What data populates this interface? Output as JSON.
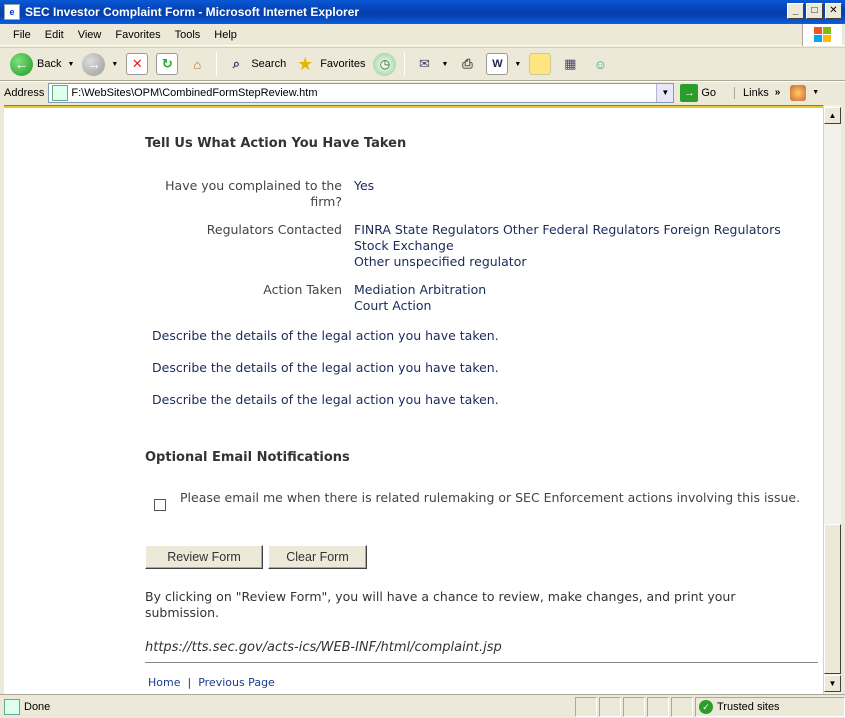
{
  "window": {
    "title": "SEC Investor Complaint Form - Microsoft Internet Explorer",
    "app_icon": "e",
    "minimize": "_",
    "maximize": "□",
    "close": "✕"
  },
  "menu": [
    "File",
    "Edit",
    "View",
    "Favorites",
    "Tools",
    "Help"
  ],
  "toolbar": {
    "back": "Back",
    "search": "Search",
    "favorites": "Favorites"
  },
  "address": {
    "label": "Address",
    "value": "F:\\WebSites\\OPM\\CombinedFormStepReview.htm",
    "go": "Go",
    "links": "Links"
  },
  "page": {
    "section1_title": "Tell Us What Action You Have Taken",
    "complained_label": "Have you complained to the firm?",
    "complained_value": "Yes",
    "regulators_label": "Regulators Contacted",
    "regulators_value": [
      "FINRA State Regulators Other Federal Regulators Foreign Regulators",
      "Stock Exchange",
      "Other unspecified regulator"
    ],
    "action_label": "Action Taken",
    "action_value": [
      "Mediation Arbitration",
      "Court Action"
    ],
    "details": [
      "Describe the details of the legal action you have taken.",
      "Describe the details of the legal action you have taken.",
      "Describe the details of the legal action you have taken."
    ],
    "section2_title": "Optional Email Notifications",
    "email_checkbox_label": "Please email me when there is related rulemaking or SEC Enforcement actions involving this issue.",
    "review_button": "Review Form",
    "clear_button": "Clear Form",
    "note": "By clicking on \"Review Form\", you will have a chance to review, make changes, and print your submission.",
    "url": "https://tts.sec.gov/acts-ics/WEB-INF/html/complaint.jsp",
    "footer_home": "Home",
    "footer_sep": "|",
    "footer_previous": "Previous Page"
  },
  "status": {
    "text": "Done",
    "zone": "Trusted sites"
  }
}
